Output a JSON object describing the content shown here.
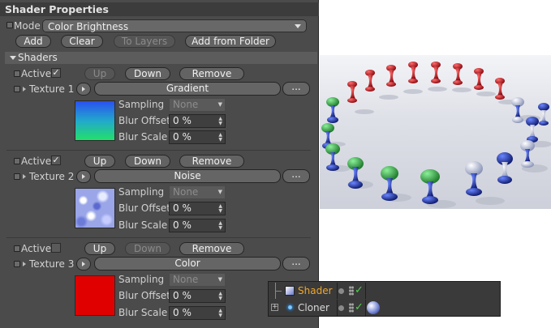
{
  "panel": {
    "title": "Shader Properties",
    "mode_label": "Mode",
    "mode_value": "Color Brightness",
    "buttons": {
      "add": "Add",
      "clear": "Clear",
      "to_layers": "To Layers",
      "add_from_folder": "Add from Folder"
    },
    "section_title": "Shaders"
  },
  "shaders": [
    {
      "active_label": "Active",
      "active": true,
      "up": "Up",
      "down": "Down",
      "remove": "Remove",
      "texture_label": "Texture 1",
      "texture_name": "Gradient",
      "more": "...",
      "sampling_label": "Sampling",
      "sampling_value": "None",
      "blur_offset_label": "Blur Offset",
      "blur_offset_value": "0 %",
      "blur_scale_label": "Blur Scale",
      "blur_scale_value": "0 %"
    },
    {
      "active_label": "Active",
      "active": true,
      "up": "Up",
      "down": "Down",
      "remove": "Remove",
      "texture_label": "Texture 2",
      "texture_name": "Noise",
      "more": "...",
      "sampling_label": "Sampling",
      "sampling_value": "None",
      "blur_offset_label": "Blur Offset",
      "blur_offset_value": "0 %",
      "blur_scale_label": "Blur Scale",
      "blur_scale_value": "0 %"
    },
    {
      "active_label": "Active",
      "active": false,
      "up": "Up",
      "down": "Down",
      "remove": "Remove",
      "texture_label": "Texture 3",
      "texture_name": "Color",
      "more": "...",
      "sampling_label": "Sampling",
      "sampling_value": "None",
      "blur_offset_label": "Blur Offset",
      "blur_offset_value": "0 %",
      "blur_scale_label": "Blur Scale",
      "blur_scale_value": "0 %"
    }
  ],
  "check_glyph": "✓",
  "object_manager": {
    "rows": [
      {
        "name": "Shader",
        "name_color": "#f0a62c",
        "icon": "shader-icon"
      },
      {
        "name": "Cloner",
        "name_color": "#d8d8d8",
        "icon": "cloner-icon"
      }
    ]
  },
  "colors": {
    "red_swatch": "#e00000",
    "pin_red": "#c8141e",
    "pin_green": "#3aa84a",
    "pin_blue": "#1f3aa8"
  }
}
